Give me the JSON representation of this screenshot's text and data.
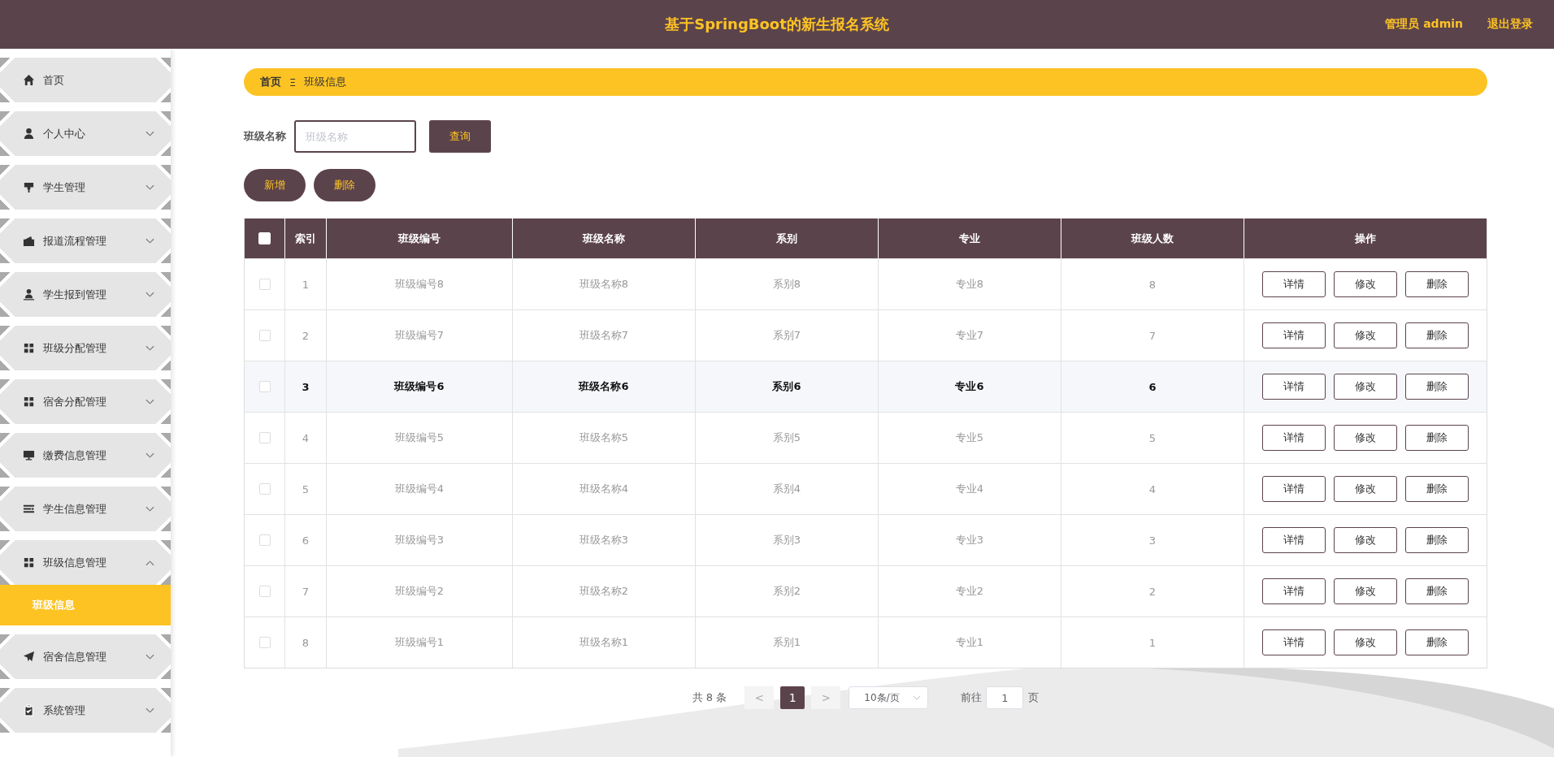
{
  "header": {
    "title": "基于SpringBoot的新生报名系统",
    "user": "管理员 admin",
    "logout": "退出登录"
  },
  "sidebar": {
    "items": [
      {
        "label": "首页",
        "kind": "link"
      },
      {
        "label": "个人中心",
        "kind": "submenu",
        "expanded": false
      },
      {
        "label": "学生管理",
        "kind": "submenu",
        "expanded": false
      },
      {
        "label": "报道流程管理",
        "kind": "submenu",
        "expanded": false
      },
      {
        "label": "学生报到管理",
        "kind": "submenu",
        "expanded": false
      },
      {
        "label": "班级分配管理",
        "kind": "submenu",
        "expanded": false
      },
      {
        "label": "宿舍分配管理",
        "kind": "submenu",
        "expanded": false
      },
      {
        "label": "缴费信息管理",
        "kind": "submenu",
        "expanded": false
      },
      {
        "label": "学生信息管理",
        "kind": "submenu",
        "expanded": false
      },
      {
        "label": "班级信息管理",
        "kind": "submenu",
        "expanded": true,
        "children": [
          {
            "label": "班级信息",
            "selected": true
          }
        ]
      },
      {
        "label": "宿舍信息管理",
        "kind": "submenu",
        "expanded": false
      },
      {
        "label": "系统管理",
        "kind": "submenu",
        "expanded": false
      }
    ]
  },
  "breadcrumb": {
    "home": "首页",
    "separator": "Ξ",
    "current": "班级信息"
  },
  "search": {
    "label": "班级名称",
    "placeholder": "班级名称",
    "button": "查询"
  },
  "actions": [
    "新增",
    "删除"
  ],
  "table": {
    "header_checked": false,
    "columns": [
      "索引",
      "班级编号",
      "班级名称",
      "系别",
      "专业",
      "班级人数",
      "操作"
    ],
    "rows": [
      {
        "checked": false,
        "highlighted": false,
        "cells": [
          "1",
          "班级编号8",
          "班级名称8",
          "系别8",
          "专业8",
          "8"
        ],
        "buttons": [
          "详情",
          "修改",
          "删除"
        ]
      },
      {
        "checked": false,
        "highlighted": false,
        "cells": [
          "2",
          "班级编号7",
          "班级名称7",
          "系别7",
          "专业7",
          "7"
        ],
        "buttons": [
          "详情",
          "修改",
          "删除"
        ]
      },
      {
        "checked": false,
        "highlighted": true,
        "cells": [
          "3",
          "班级编号6",
          "班级名称6",
          "系别6",
          "专业6",
          "6"
        ],
        "buttons": [
          "详情",
          "修改",
          "删除"
        ]
      },
      {
        "checked": false,
        "highlighted": false,
        "cells": [
          "4",
          "班级编号5",
          "班级名称5",
          "系别5",
          "专业5",
          "5"
        ],
        "buttons": [
          "详情",
          "修改",
          "删除"
        ]
      },
      {
        "checked": false,
        "highlighted": false,
        "cells": [
          "5",
          "班级编号4",
          "班级名称4",
          "系别4",
          "专业4",
          "4"
        ],
        "buttons": [
          "详情",
          "修改",
          "删除"
        ]
      },
      {
        "checked": false,
        "highlighted": false,
        "cells": [
          "6",
          "班级编号3",
          "班级名称3",
          "系别3",
          "专业3",
          "3"
        ],
        "buttons": [
          "详情",
          "修改",
          "删除"
        ]
      },
      {
        "checked": false,
        "highlighted": false,
        "cells": [
          "7",
          "班级编号2",
          "班级名称2",
          "系别2",
          "专业2",
          "2"
        ],
        "buttons": [
          "详情",
          "修改",
          "删除"
        ]
      },
      {
        "checked": false,
        "highlighted": false,
        "cells": [
          "8",
          "班级编号1",
          "班级名称1",
          "系别1",
          "专业1",
          "1"
        ],
        "buttons": [
          "详情",
          "修改",
          "删除"
        ]
      }
    ]
  },
  "pagination": {
    "total": "共 8 条",
    "prev": "<",
    "pages": [
      {
        "label": "1",
        "selected": true
      }
    ],
    "next": ">",
    "page_size": "10条/页",
    "goto_label": "前往",
    "goto_value": "1",
    "goto_suffix": "页"
  }
}
